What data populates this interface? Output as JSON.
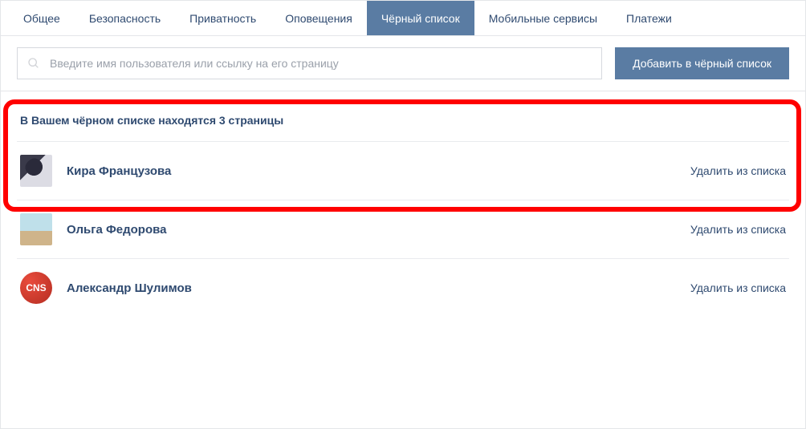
{
  "tabs": [
    {
      "label": "Общее"
    },
    {
      "label": "Безопасность"
    },
    {
      "label": "Приватность"
    },
    {
      "label": "Оповещения"
    },
    {
      "label": "Чёрный список",
      "active": true
    },
    {
      "label": "Мобильные сервисы"
    },
    {
      "label": "Платежи"
    }
  ],
  "search": {
    "placeholder": "Введите имя пользователя или ссылку на его страницу"
  },
  "add_button": "Добавить в чёрный список",
  "list_title": "В Вашем чёрном списке находятся 3 страницы",
  "remove_label": "Удалить из списка",
  "users": [
    {
      "name": "Кира Французова",
      "avatar": "kira"
    },
    {
      "name": "Ольга Федорова",
      "avatar": "sky"
    },
    {
      "name": "Александр Шулимов",
      "avatar": "cns",
      "avatar_text": "CNS"
    }
  ]
}
